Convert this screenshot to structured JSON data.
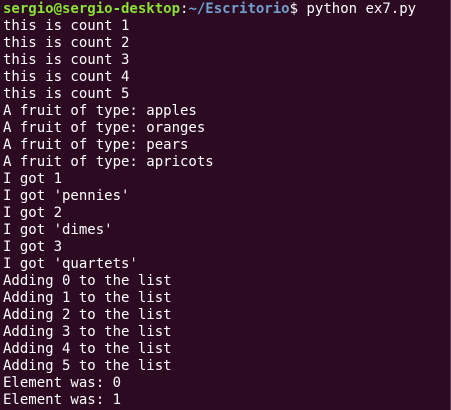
{
  "prompt": {
    "user_host": "sergio@sergio-desktop",
    "separator": ":",
    "path": "~/Escritorio",
    "sign": "$",
    "command": " python ex7.py"
  },
  "output_lines": [
    "this is count 1",
    "this is count 2",
    "this is count 3",
    "this is count 4",
    "this is count 5",
    "A fruit of type: apples",
    "A fruit of type: oranges",
    "A fruit of type: pears",
    "A fruit of type: apricots",
    "I got 1",
    "I got 'pennies'",
    "I got 2",
    "I got 'dimes'",
    "I got 3",
    "I got 'quartets'",
    "Adding 0 to the list",
    "Adding 1 to the list",
    "Adding 2 to the list",
    "Adding 3 to the list",
    "Adding 4 to the list",
    "Adding 5 to the list",
    "Element was: 0",
    "Element was: 1"
  ],
  "colors": {
    "background": "#2c0a22",
    "text": "#ffffff",
    "prompt_user": "#8ae234",
    "prompt_path": "#729fcf"
  }
}
